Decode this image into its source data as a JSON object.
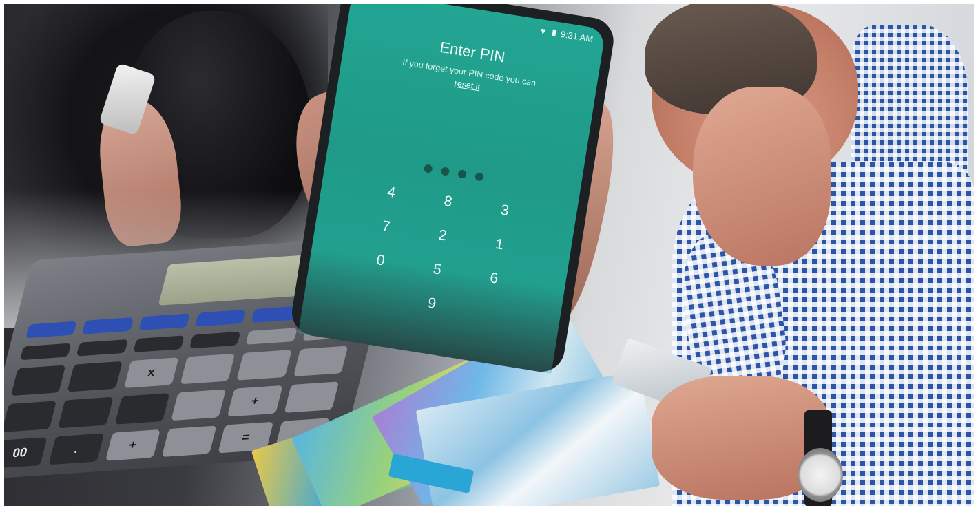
{
  "phone_screen": {
    "status_time": "9:31 AM",
    "title": "Enter PIN",
    "hint": "If you forget your PIN code you can",
    "reset_link": "reset it",
    "keypad": [
      "4",
      "8",
      "3",
      "7",
      "2",
      "1",
      "0",
      "5",
      "6",
      "",
      "9",
      ""
    ]
  },
  "calculator": {
    "keys": [
      "",
      "",
      "",
      "",
      "",
      "",
      "",
      "",
      "",
      "",
      "",
      "",
      "",
      "",
      "x",
      "",
      "",
      "",
      "",
      "",
      "",
      "",
      "+",
      "",
      "00",
      ".",
      "+",
      "",
      "=",
      ""
    ]
  },
  "colors": {
    "phone_screen": "#22a08f",
    "shirt_blue": "#2b55a6",
    "calc_blue_keys": "#2e4fb3"
  }
}
